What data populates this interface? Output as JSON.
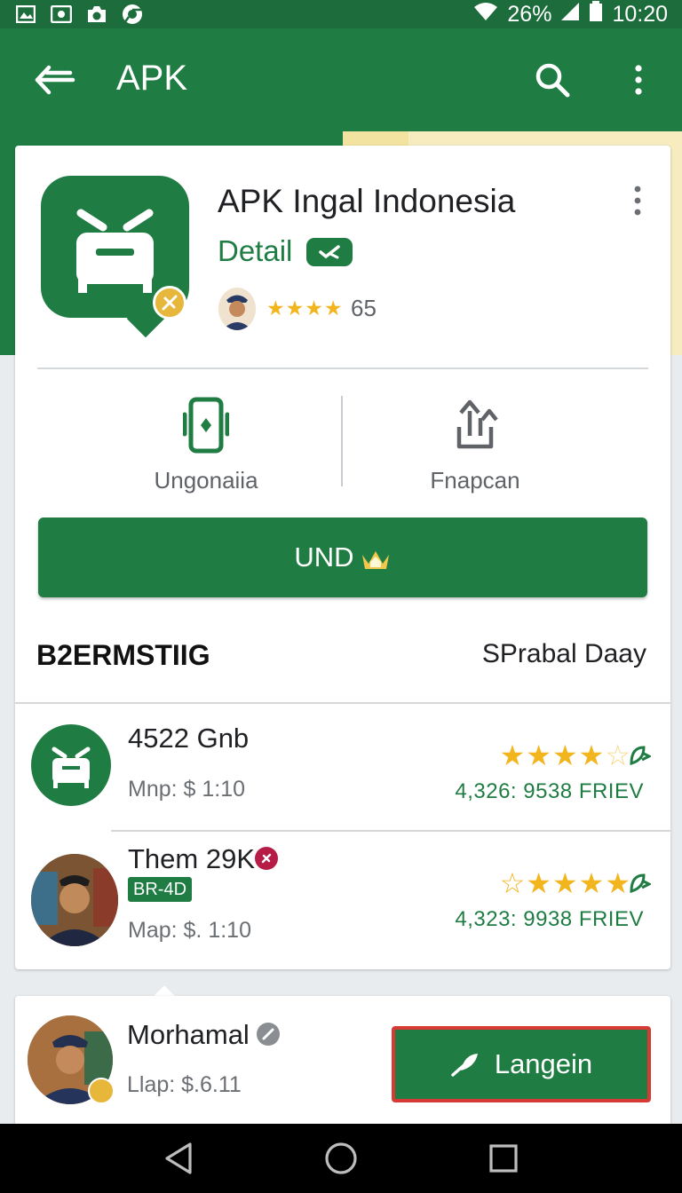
{
  "status_bar": {
    "battery": "26%",
    "time": "10:20",
    "icons": [
      "gallery-icon",
      "image-icon",
      "camera-icon",
      "chrome-icon",
      "wifi-icon",
      "signal-icon",
      "battery-icon"
    ]
  },
  "app_bar": {
    "title": "APK",
    "back_icon": "back-arrow-icon",
    "search_icon": "search-icon",
    "menu_icon": "more-vert-icon"
  },
  "app": {
    "name": "APK Ingal Indonesia",
    "detail_label": "Detail",
    "rating_stars": "★★★★",
    "rating_count": "65"
  },
  "actions": {
    "left_label": "Ungonaiia",
    "right_label": "Fnapcan"
  },
  "install_button": {
    "label": "UND"
  },
  "section": {
    "title": "B2ERMSTIIG",
    "link": "SPrabal Daay"
  },
  "list": [
    {
      "title": "4522 Gnb",
      "subtitle": "Mnp: $  1:10",
      "stars": "★★★★",
      "empty_stars": "☆",
      "stats": "4,326:  9538  FRIEV"
    },
    {
      "title": "Them 29K",
      "tag": "BR-4D",
      "subtitle": "Map: $. 1:10",
      "stars": "☆★★★★",
      "stats": "4,323:  9938  FRIEV"
    }
  ],
  "bottom_card": {
    "name": "Morhamal",
    "subtitle": "Llap: $.6.11",
    "button_label": "Langein"
  },
  "colors": {
    "primary": "#1f7d44",
    "accent_yellow": "#f2b51e",
    "highlight_red": "#d73a35"
  }
}
